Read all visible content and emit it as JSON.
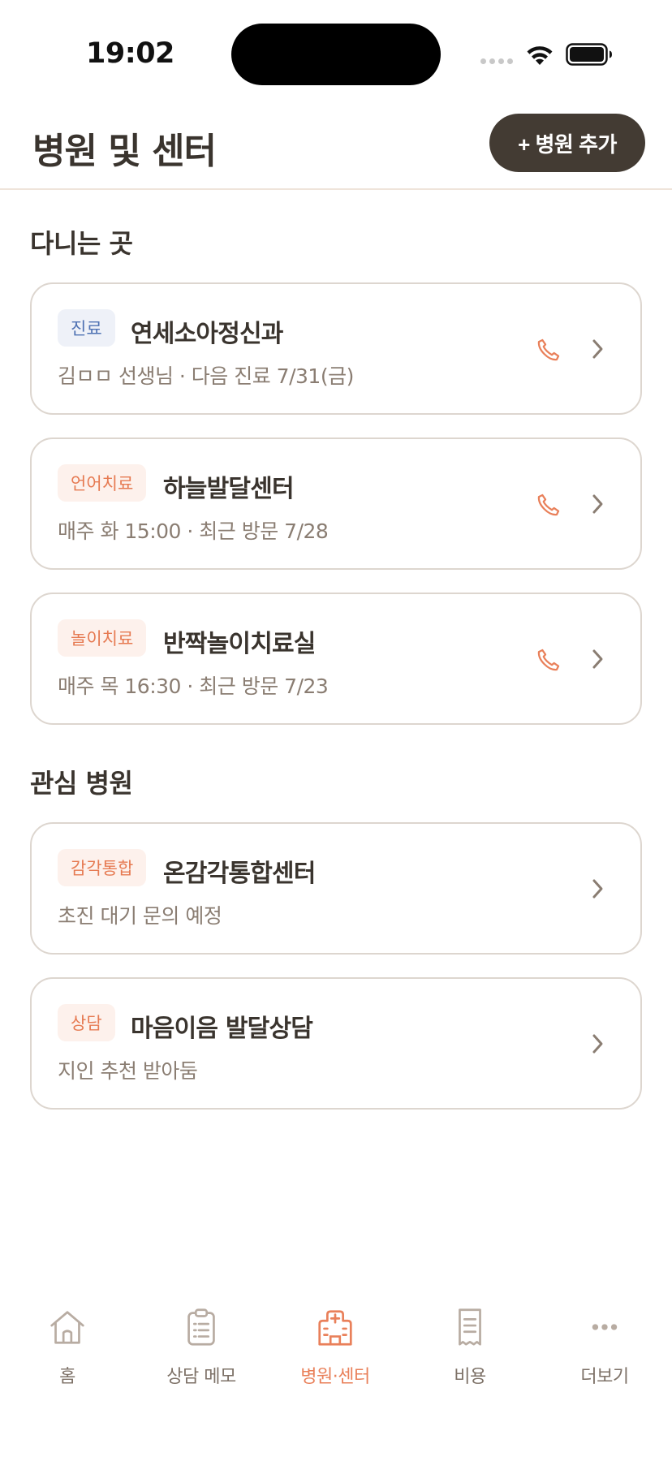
{
  "status_bar": {
    "time": "19:02"
  },
  "header": {
    "title": "병원 및 센터",
    "add_button": "+ 병원 추가"
  },
  "sections": {
    "current": {
      "title": "다니는 곳",
      "items": [
        {
          "tag": "진료",
          "tag_color": "#4f72b3",
          "name": "연세소아정신과",
          "sub": "김ㅁㅁ 선생님 · 다음 진료 7/31(금)",
          "has_phone": true
        },
        {
          "tag": "언어치료",
          "tag_color": "#e67a52",
          "name": "하늘발달센터",
          "sub": "매주 화 15:00 · 최근 방문 7/28",
          "has_phone": true
        },
        {
          "tag": "놀이치료",
          "tag_color": "#e67a52",
          "name": "반짝놀이치료실",
          "sub": "매주 목 16:30 · 최근 방문 7/23",
          "has_phone": true
        }
      ]
    },
    "interest": {
      "title": "관심 병원",
      "items": [
        {
          "tag": "감각통합",
          "tag_color": "#e67a52",
          "name": "온감각통합센터",
          "sub": "초진 대기 문의 예정",
          "has_phone": false
        },
        {
          "tag": "상담",
          "tag_color": "#e67a52",
          "name": "마음이음 발달상담",
          "sub": "지인 추천 받아둠",
          "has_phone": false
        }
      ]
    }
  },
  "tab_bar": {
    "active": "tab-centers",
    "accent_color": "#e9805a",
    "items": [
      {
        "label": "홈",
        "icon": "home-icon"
      },
      {
        "label": "상담 메모",
        "icon": "clipboard-icon"
      },
      {
        "label": "병원·센터",
        "icon": "hospital-icon"
      },
      {
        "label": "비용",
        "icon": "receipt-icon"
      },
      {
        "label": "더보기",
        "icon": "more-icon"
      }
    ]
  }
}
